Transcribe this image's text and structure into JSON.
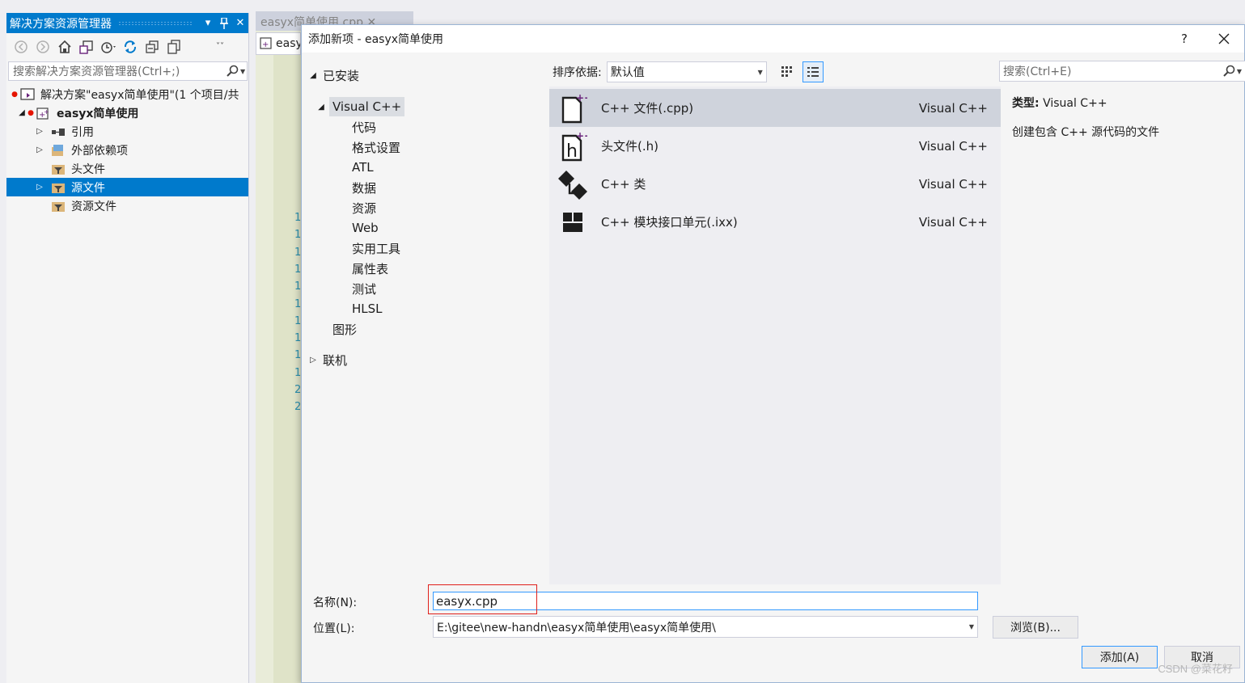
{
  "solution_explorer": {
    "title": "解决方案资源管理器",
    "search_placeholder": "搜索解决方案资源管理器(Ctrl+;)",
    "tree": {
      "solution": "解决方案\"easyx简单使用\"(1 个项目/共",
      "project": "easyx简单使用",
      "references": "引用",
      "external_deps": "外部依赖项",
      "header_files": "头文件",
      "source_files": "源文件",
      "resource_files": "资源文件"
    }
  },
  "editor": {
    "tab_title": "easyx简单使用.cpp",
    "tab_close": "✕",
    "strip_label": "easy",
    "line_numbers": [
      "1",
      "1",
      "1",
      "1",
      "1",
      "1",
      "1",
      "1",
      "1",
      "1",
      "2",
      "2"
    ]
  },
  "dialog": {
    "title": "添加新项 - easyx简单使用",
    "help": "?",
    "installed_label": "已安装",
    "categories": {
      "root": "Visual C++",
      "children": [
        "代码",
        "格式设置",
        "ATL",
        "数据",
        "资源",
        "Web",
        "实用工具",
        "属性表",
        "测试",
        "HLSL"
      ],
      "graphics": "图形"
    },
    "online_label": "联机",
    "sort_label": "排序依据:",
    "sort_value": "默认值",
    "search_placeholder": "搜索(Ctrl+E)",
    "templates": [
      {
        "name": "C++ 文件(.cpp)",
        "lang": "Visual C++",
        "icon": "cpp-file-icon"
      },
      {
        "name": "头文件(.h)",
        "lang": "Visual C++",
        "icon": "header-file-icon"
      },
      {
        "name": "C++ 类",
        "lang": "Visual C++",
        "icon": "cpp-class-icon"
      },
      {
        "name": "C++ 模块接口单元(.ixx)",
        "lang": "Visual C++",
        "icon": "module-unit-icon"
      }
    ],
    "details": {
      "type_label": "类型:",
      "type_value": "Visual C++",
      "description": "创建包含 C++ 源代码的文件"
    },
    "name_label": "名称(N):",
    "name_value": "easyx.cpp",
    "location_label": "位置(L):",
    "location_value": "E:\\gitee\\new-handn\\easyx简单使用\\easyx简单使用\\",
    "browse_button": "浏览(B)...",
    "add_button": "添加(A)",
    "cancel_button": "取消"
  },
  "watermark": "CSDN @菜花籽",
  "colors": {
    "accent": "#007acc",
    "selection": "#007acc",
    "highlight_box": "#e0201b",
    "dialog_bg": "#f5f5f5",
    "list_bg": "#eeeef2"
  }
}
